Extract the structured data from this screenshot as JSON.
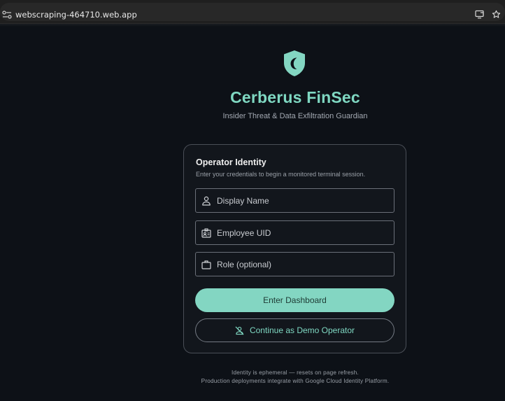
{
  "browser": {
    "url": "webscraping-464710.web.app"
  },
  "header": {
    "app_title": "Cerberus FinSec",
    "subtitle": "Insider Threat & Data Exfiltration Guardian",
    "logo_icon": "shield-moon-icon"
  },
  "card": {
    "title": "Operator Identity",
    "description": "Enter your credentials to begin a monitored terminal session.",
    "fields": [
      {
        "placeholder": "Display Name",
        "value": "",
        "icon": "person-icon"
      },
      {
        "placeholder": "Employee UID",
        "value": "",
        "icon": "badge-icon"
      },
      {
        "placeholder": "Role (optional)",
        "value": "",
        "icon": "briefcase-icon"
      }
    ],
    "primary_button": "Enter Dashboard",
    "secondary_button": "Continue as Demo Operator",
    "secondary_icon": "person-off-icon"
  },
  "footer": {
    "line1": "Identity is ephemeral — resets on page refresh.",
    "line2": "Production deployments integrate with Google Cloud Identity Platform."
  },
  "colors": {
    "background": "#0d1117",
    "accent": "#7fd8c2",
    "button_fill": "#83d6c2",
    "button_text": "#1d3a33",
    "card_border": "#4a4f57"
  }
}
